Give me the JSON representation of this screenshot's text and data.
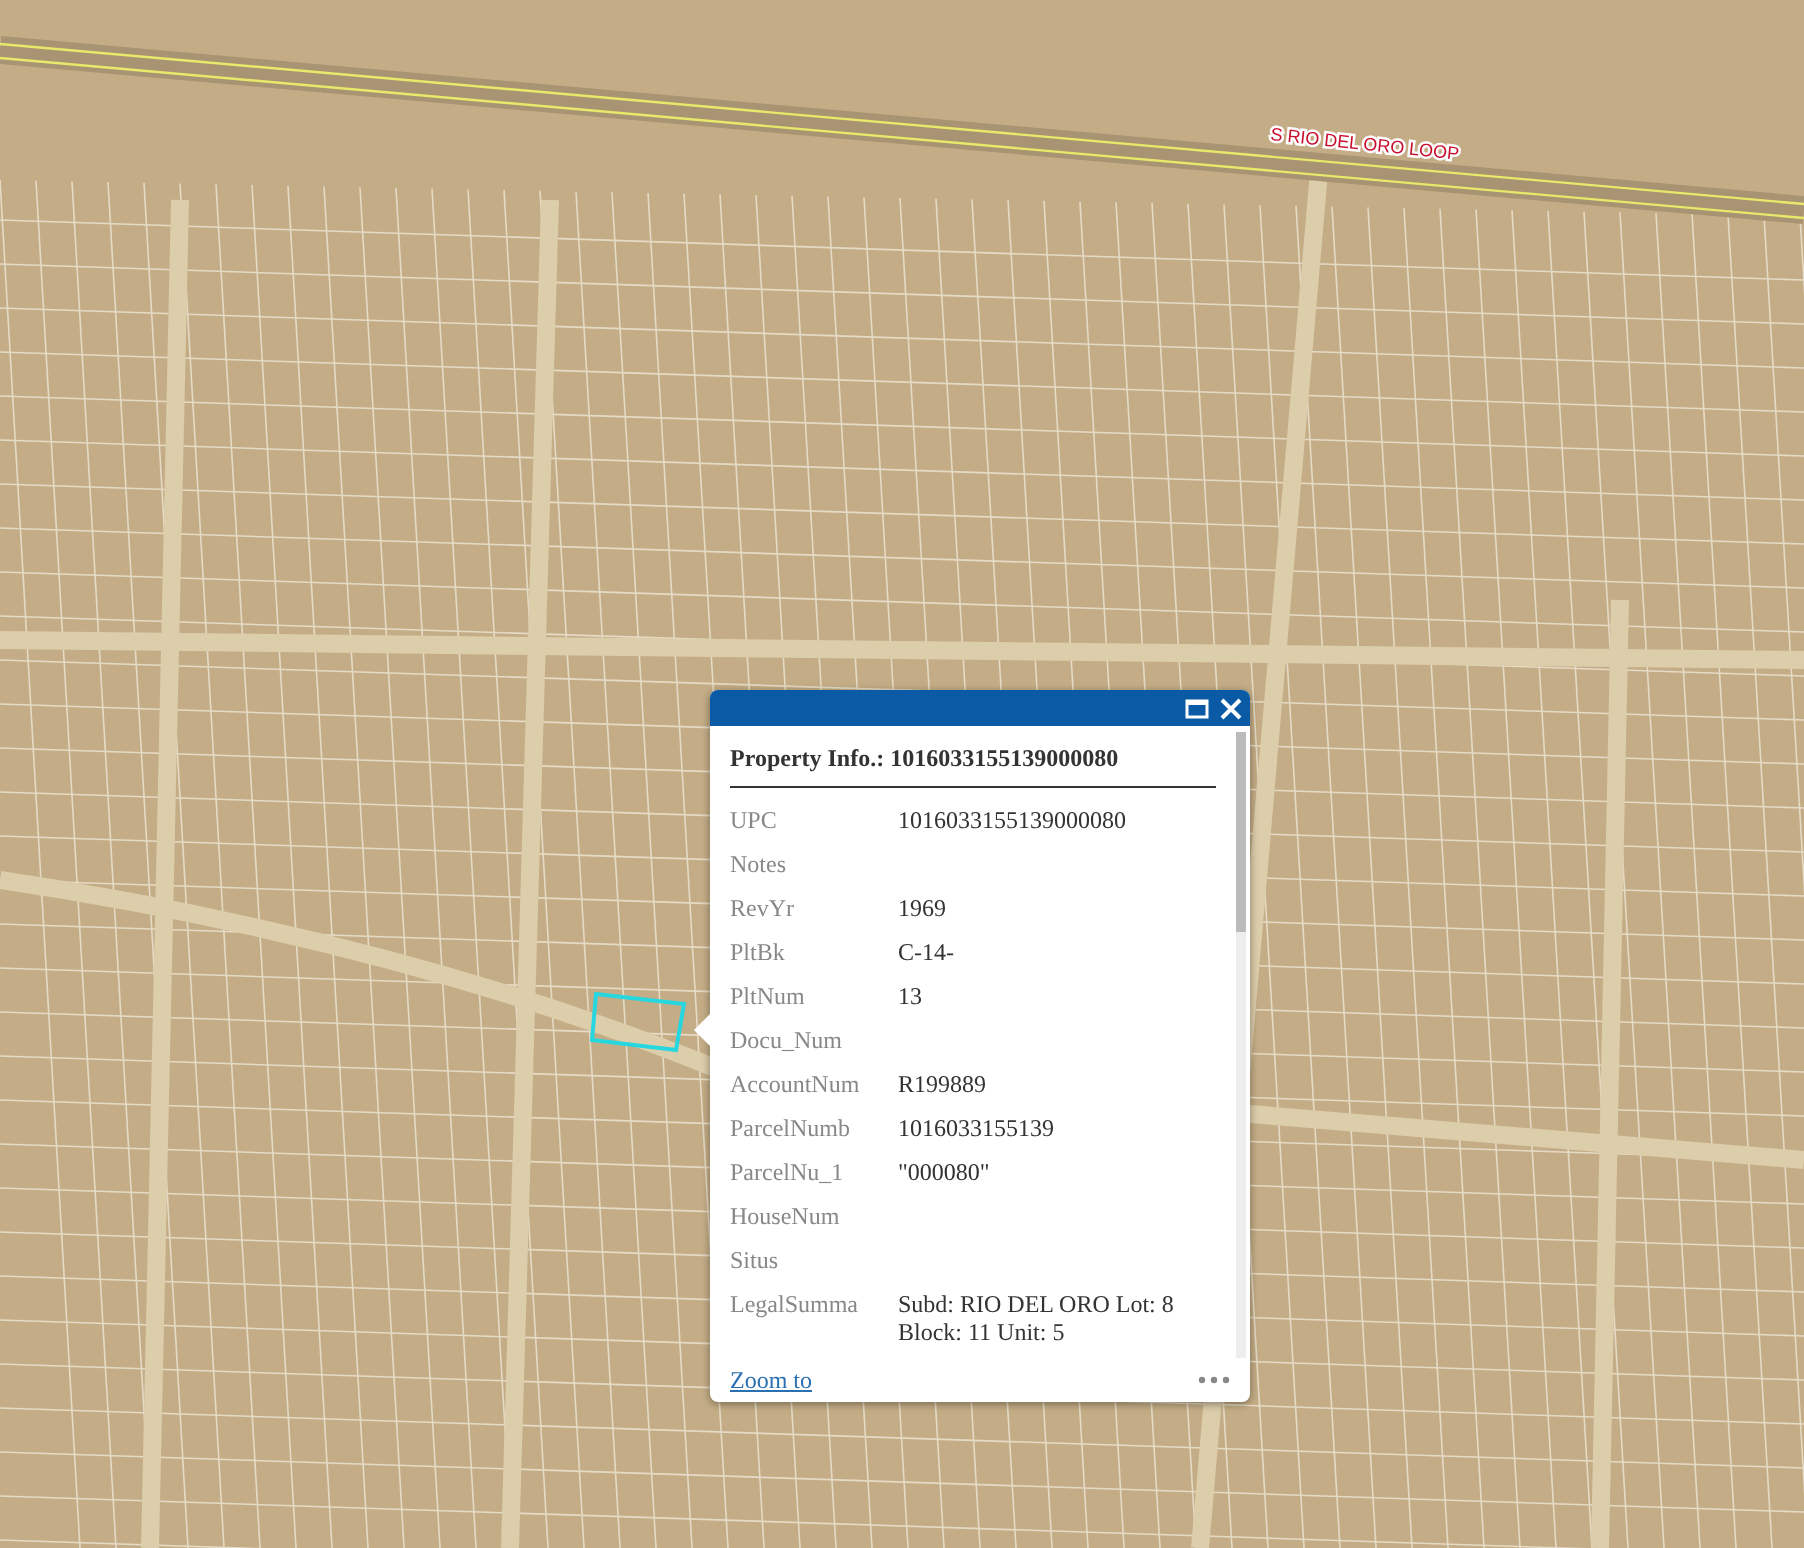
{
  "map": {
    "road_label": "S RIO DEL ORO LOOP"
  },
  "popup": {
    "title": "Property Info.: 1016033155139000080",
    "fields": [
      {
        "label": "UPC",
        "value": "1016033155139000080"
      },
      {
        "label": "Notes"
      },
      {
        "label": "RevYr",
        "value": "1969"
      },
      {
        "label": "PltBk",
        "value": "C-14-"
      },
      {
        "label": "PltNum",
        "value": "13"
      },
      {
        "label": "Docu_Num"
      },
      {
        "label": "AccountNum",
        "value": "R199889"
      },
      {
        "label": "ParcelNumb",
        "value": "1016033155139"
      },
      {
        "label": "ParcelNu_1",
        "value": "\"000080\""
      },
      {
        "label": "HouseNum"
      },
      {
        "label": "Situs"
      },
      {
        "label": "LegalSumma",
        "value": "Subd: RIO DEL ORO Lot: 8 Block: 11 Unit: 5"
      }
    ],
    "link": "Zoom to"
  }
}
